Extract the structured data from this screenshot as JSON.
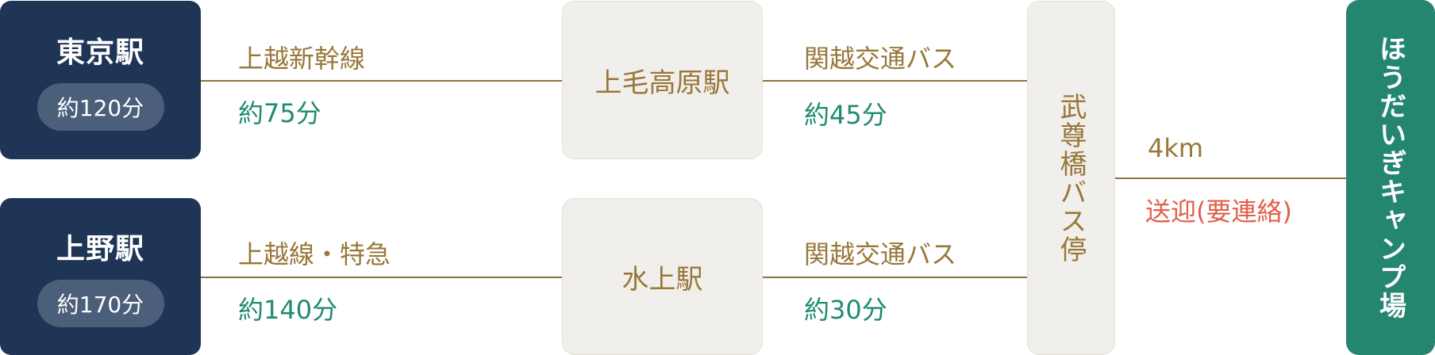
{
  "origins": [
    {
      "name": "東京駅",
      "time": "約120分"
    },
    {
      "name": "上野駅",
      "time": "約170分"
    }
  ],
  "legs": {
    "tokyo_rail": {
      "mode": "上越新幹線",
      "time": "約75分"
    },
    "ueno_rail": {
      "mode": "上越線・特急",
      "time": "約140分"
    },
    "upper_bus": {
      "mode": "関越交通バス",
      "time": "約45分"
    },
    "lower_bus": {
      "mode": "関越交通バス",
      "time": "約30分"
    },
    "final": {
      "distance": "4km",
      "note": "送迎(要連絡)"
    }
  },
  "stations": {
    "jomokogen": "上毛高原駅",
    "minakami": "水上駅",
    "bus_stop": "武尊橋バス停"
  },
  "destination": "ほうだいぎキャンプ場",
  "colors": {
    "navy": "#1e3556",
    "gold": "#98773a",
    "teal": "#1e8b70",
    "red": "#e0604a",
    "station_bg": "#f1efeb",
    "destination_bg": "#258670"
  }
}
